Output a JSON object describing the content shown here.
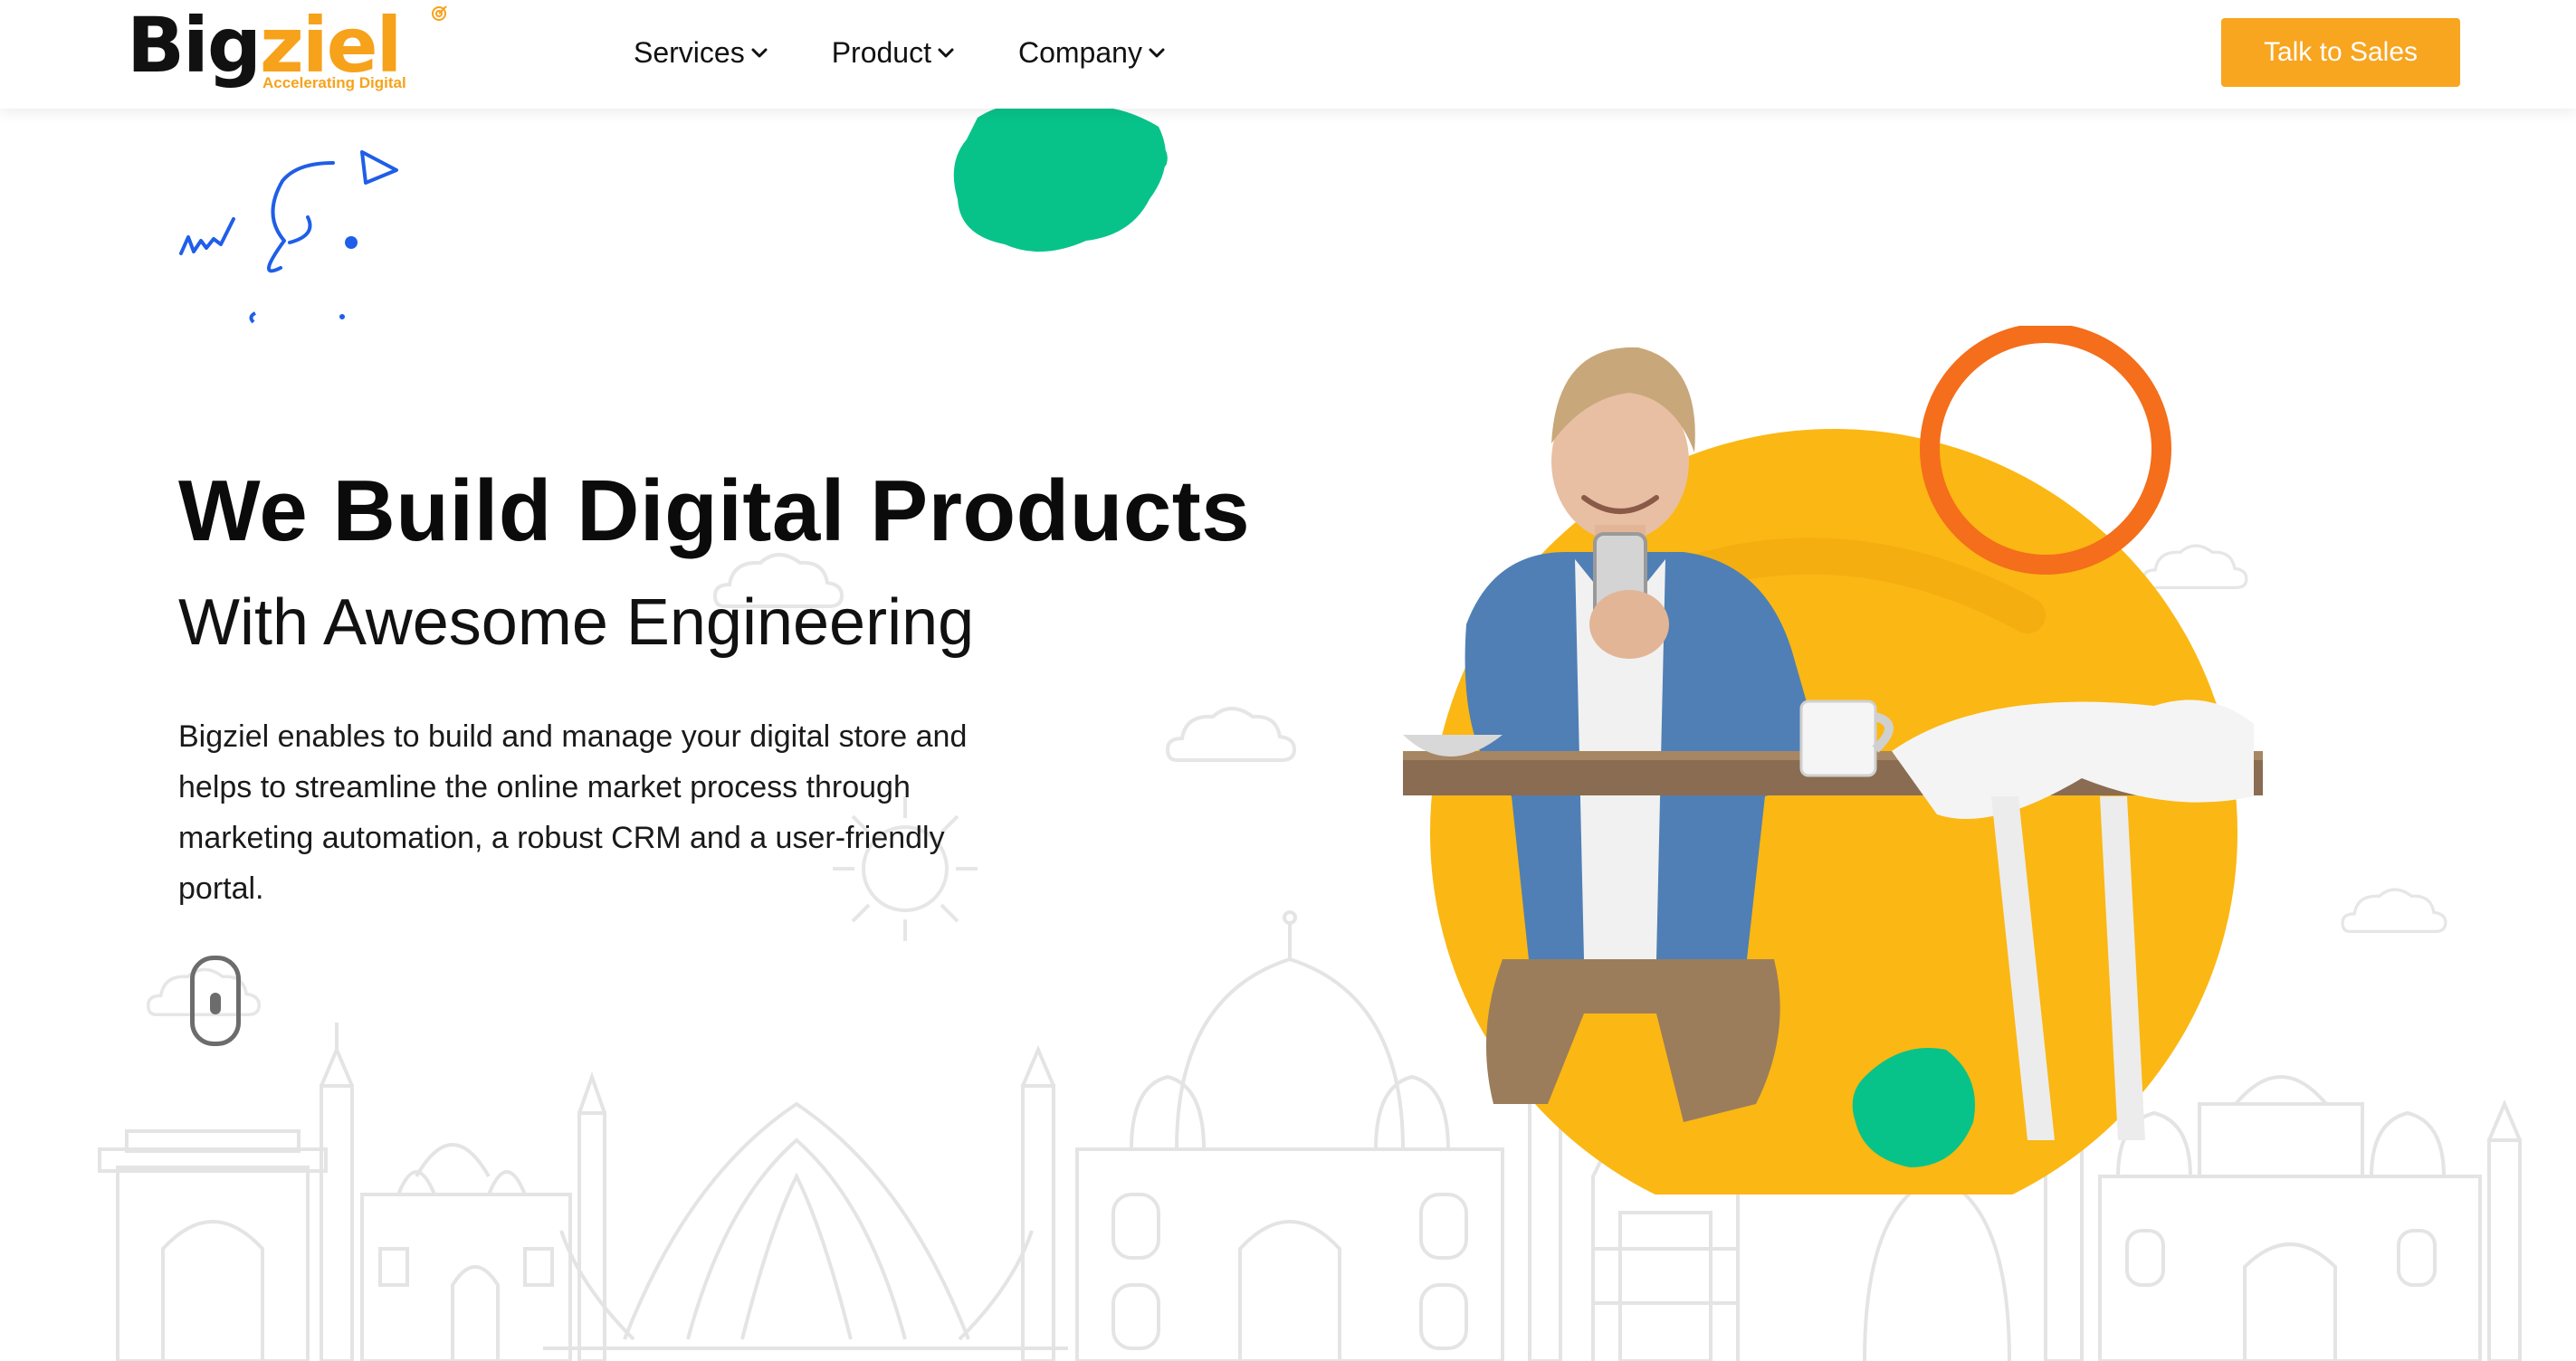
{
  "header": {
    "logo": {
      "word_main": "Big",
      "word_accent": "ziel",
      "tagline": "Accelerating Digital"
    },
    "nav": [
      {
        "label": "Services",
        "icon": "chevron-down-icon"
      },
      {
        "label": "Product",
        "icon": "chevron-down-icon"
      },
      {
        "label": "Company",
        "icon": "chevron-down-icon"
      }
    ],
    "cta_label": "Talk to Sales"
  },
  "hero": {
    "title": "We Build Digital Products",
    "subtitle": "With Awesome Engineering",
    "description": "Bigziel enables to build and manage your digital store and helps to streamline the online market process through marketing automation, a robust CRM and a user-friendly portal."
  },
  "colors": {
    "brand_orange": "#f7a21b",
    "cta_orange": "#f8a51f",
    "circle_yellow": "#fbb713",
    "ring_orange": "#f46e1b",
    "green_splash": "#08c389",
    "doodle_blue": "#1f5ee8",
    "skyline_gray": "#e6e6e6"
  },
  "icons": [
    "chevron-down-icon",
    "paper-plane-icon",
    "scroll-mouse-icon",
    "target-icon"
  ]
}
